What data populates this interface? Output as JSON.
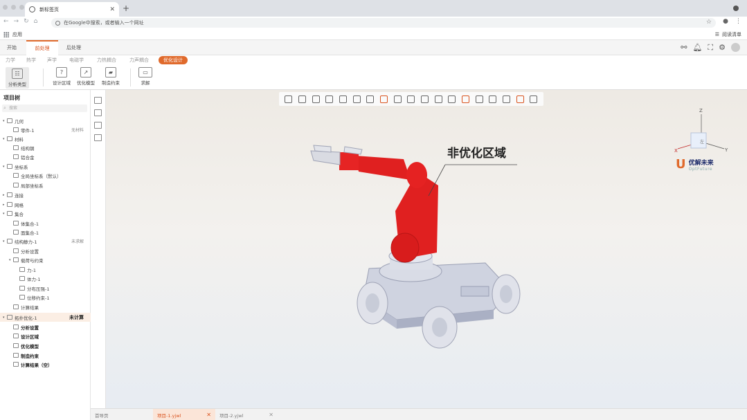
{
  "browser": {
    "tab_title": "新标签页",
    "address_placeholder": "在Google中搜索，或者输入一个网址",
    "bookmarks_apps": "应用",
    "reading_list": "阅读清单"
  },
  "app": {
    "tabs": [
      {
        "label": "开始"
      },
      {
        "label": "前处理"
      },
      {
        "label": "后处理"
      }
    ],
    "sub_tabs": [
      {
        "label": "力学"
      },
      {
        "label": "热学"
      },
      {
        "label": "声学"
      },
      {
        "label": "电磁学"
      },
      {
        "label": "力热耦合"
      },
      {
        "label": "力声耦合"
      },
      {
        "label": "优化设计"
      }
    ],
    "toolbar": {
      "analysis_type": "分析类型",
      "design_region": "设计区域",
      "opt_model": "优化模型",
      "manufacture_constraint": "制造约束",
      "solve": "求解"
    }
  },
  "project_tree": {
    "title": "项目树",
    "search_placeholder": "搜索",
    "rows": [
      {
        "label": "几何",
        "side": ""
      },
      {
        "label": "零件-1",
        "side": "无材料"
      },
      {
        "label": "材料",
        "side": ""
      },
      {
        "label": "结构钢",
        "side": ""
      },
      {
        "label": "铝合金",
        "side": ""
      },
      {
        "label": "坐标系",
        "side": ""
      },
      {
        "label": "全局坐标系（默认）",
        "side": ""
      },
      {
        "label": "局部坐标系",
        "side": ""
      },
      {
        "label": "连接",
        "side": ""
      },
      {
        "label": "网格",
        "side": ""
      },
      {
        "label": "集合",
        "side": ""
      },
      {
        "label": "体集合-1",
        "side": ""
      },
      {
        "label": "面集合-1",
        "side": ""
      },
      {
        "label": "结构静力-1",
        "side": "未求解"
      },
      {
        "label": "分析设置",
        "side": ""
      },
      {
        "label": "载荷与约束",
        "side": ""
      },
      {
        "label": "力-1",
        "side": ""
      },
      {
        "label": "体力-1",
        "side": ""
      },
      {
        "label": "分布压强-1",
        "side": ""
      },
      {
        "label": "位移约束-1",
        "side": ""
      },
      {
        "label": "计算结果",
        "side": ""
      },
      {
        "label": "拓扑优化-1",
        "side": "未计算"
      },
      {
        "label": "分析设置",
        "side": ""
      },
      {
        "label": "设计区域",
        "side": ""
      },
      {
        "label": "优化模型",
        "side": ""
      },
      {
        "label": "制造约束",
        "side": ""
      },
      {
        "label": "计算结果（空）",
        "side": ""
      }
    ]
  },
  "viewport": {
    "callout": "非优化区域",
    "logo_name": "优解未来",
    "logo_sub": "OptFuture",
    "axes": {
      "z": "Z",
      "x": "X",
      "y": "Y"
    },
    "cube_face": "左"
  },
  "doc_tabs": [
    {
      "label": "首导页"
    },
    {
      "label": "项目-1.yjwl"
    },
    {
      "label": "项目-2.yjwl"
    }
  ],
  "colors": {
    "accent": "#e06a2c",
    "red_part": "#e02020",
    "logo_blue": "#1d2c6b"
  }
}
